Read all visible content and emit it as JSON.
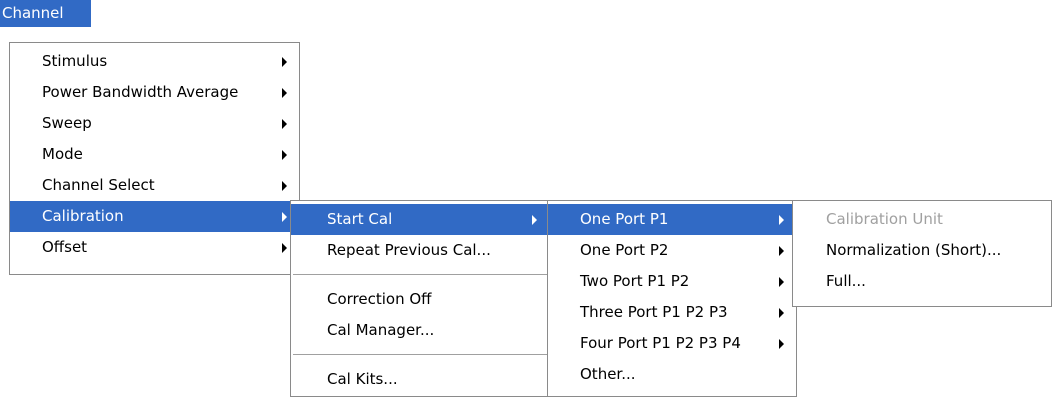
{
  "menubar": {
    "channel": "Channel"
  },
  "channel_menu": [
    {
      "label": "Stimulus",
      "submenu": true
    },
    {
      "label": "Power Bandwidth Average",
      "submenu": true
    },
    {
      "label": "Sweep",
      "submenu": true
    },
    {
      "label": "Mode",
      "submenu": true
    },
    {
      "label": "Channel Select",
      "submenu": true
    },
    {
      "label": "Calibration",
      "submenu": true,
      "selected": true
    },
    {
      "label": "Offset",
      "submenu": true
    }
  ],
  "calibration_menu": {
    "start_cal": "Start Cal",
    "repeat_previous_cal": "Repeat Previous Cal...",
    "correction_off": "Correction Off",
    "cal_manager": "Cal Manager...",
    "cal_kits": "Cal Kits..."
  },
  "start_cal_menu": [
    {
      "label": "One Port P1",
      "submenu": true,
      "selected": true
    },
    {
      "label": "One Port P2",
      "submenu": true
    },
    {
      "label": "Two Port P1 P2",
      "submenu": true
    },
    {
      "label": "Three Port P1 P2 P3",
      "submenu": true
    },
    {
      "label": "Four Port P1 P2 P3 P4",
      "submenu": true
    },
    {
      "label": "Other...",
      "submenu": false
    }
  ],
  "one_port_menu": {
    "calibration_unit": "Calibration Unit",
    "normalization_short": "Normalization (Short)...",
    "full": "Full..."
  },
  "colors": {
    "highlight": "#316ac5",
    "disabled_text": "#a0a0a0"
  }
}
